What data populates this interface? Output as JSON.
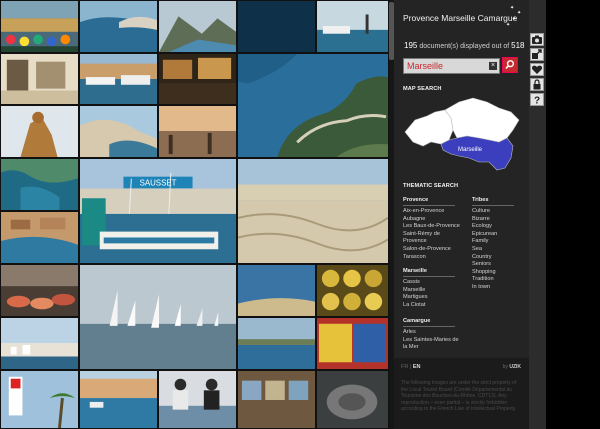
{
  "panel": {
    "title": "Provence Marseille Camargue",
    "doc_count": "195",
    "doc_count_text": "document(s) displayed out of",
    "doc_total": "518",
    "search": {
      "value": "Marseille"
    },
    "map_search_heading": "MAP SEARCH",
    "map_selected_label": "Marseille",
    "thematic_heading": "THEMATIC SEARCH"
  },
  "thematic": {
    "provence": {
      "heading": "Provence",
      "items": [
        "Aix-en-Provence",
        "Aubagne",
        "Les Baux-de-Provence",
        "Saint-Rémy de Provence",
        "Salon-de-Provence",
        "Tarascon"
      ]
    },
    "marseille": {
      "heading": "Marseille",
      "items": [
        "Cassis",
        "Marseille",
        "Martigues",
        "La Ciotat"
      ]
    },
    "camargue": {
      "heading": "Camargue",
      "items": [
        "Arles",
        "Les Saintes-Maries de la Mer"
      ]
    },
    "tribes": {
      "heading": "Tribes",
      "items": [
        "Culture",
        "Bizarre",
        "Ecology",
        "Epicurean",
        "Family",
        "Sea",
        "Country",
        "Seniors",
        "Shopping",
        "Tradition",
        "In town"
      ]
    }
  },
  "footer": {
    "lang_fr": "FR",
    "lang_en": "EN",
    "by": "by",
    "brand": "UZIK",
    "legal": "The following images are under the strict property of the Local Tourist Board (Comité Départemental du Tourisme des Bouches-du-Rhône, CDT13). Any reproduction – even partial – is strictly forbidden according to the French Law of Intellectual Property."
  },
  "toolbar": {
    "icons": [
      "camera-icon",
      "share-icon",
      "heart-icon",
      "lock-icon",
      "help-icon"
    ]
  },
  "colors": {
    "accent": "#c62a30",
    "region_selected": "#3b3fbd",
    "panel_bg": "#242424"
  }
}
